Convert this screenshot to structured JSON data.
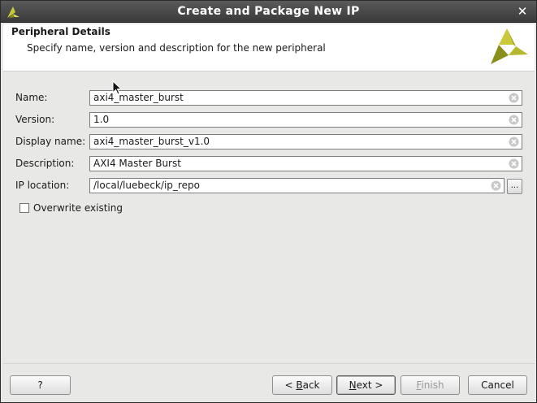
{
  "window": {
    "title": "Create and Package New IP",
    "close_glyph": "✕"
  },
  "header": {
    "title": "Peripheral Details",
    "subtitle": "Specify name, version and description for the new peripheral"
  },
  "form": {
    "fields": [
      {
        "label": "Name:",
        "value": "axi4_master_burst"
      },
      {
        "label": "Version:",
        "value": "1.0"
      },
      {
        "label": "Display name:",
        "value": "axi4_master_burst_v1.0"
      },
      {
        "label": "Description:",
        "value": "AXI4 Master Burst"
      },
      {
        "label": "IP location:",
        "value": "/local/luebeck/ip_repo"
      }
    ],
    "browse_label": "...",
    "overwrite_label": "Overwrite existing",
    "overwrite_checked": false
  },
  "footer": {
    "help_label": "?",
    "back_prefix": "< ",
    "back_mnemonic": "B",
    "back_rest": "ack",
    "next_mnemonic": "N",
    "next_rest": "ext >",
    "finish_mnemonic": "F",
    "finish_rest": "inish",
    "cancel_label": "Cancel"
  },
  "colors": {
    "brand": "#8a8f1c",
    "titlebar": "#474747"
  },
  "icons": {
    "app": "vivado-logo-icon",
    "header": "vivado-logo-icon",
    "clear": "clear-field-icon",
    "close": "close-icon"
  }
}
